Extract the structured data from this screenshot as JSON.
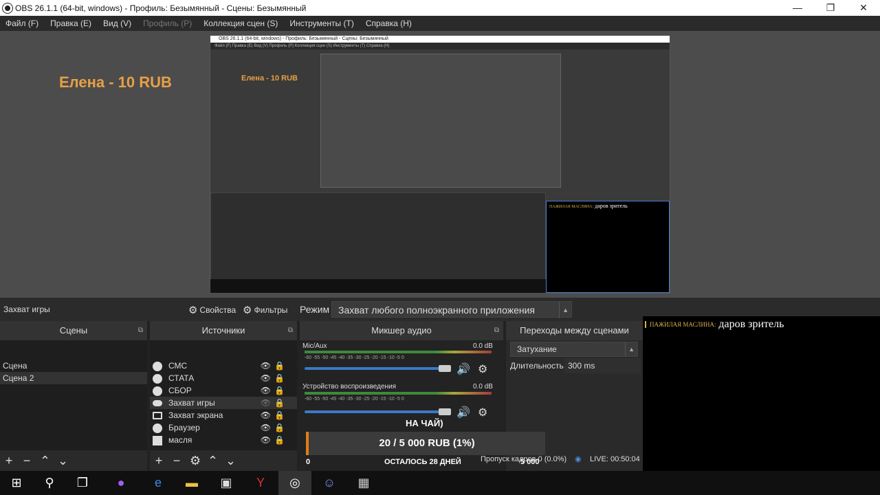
{
  "window": {
    "title": "OBS 26.1.1 (64-bit, windows) - Профиль: Безымянный - Сцены: Безымянный",
    "minimize": "—",
    "maximize": "❐",
    "close": "✕"
  },
  "menu": {
    "items": [
      {
        "label": "Файл (F)",
        "disabled": false
      },
      {
        "label": "Правка (E)",
        "disabled": false
      },
      {
        "label": "Вид (V)",
        "disabled": false
      },
      {
        "label": "Профиль (P)",
        "disabled": true
      },
      {
        "label": "Коллекция сцен (S)",
        "disabled": false
      },
      {
        "label": "Инструменты (T)",
        "disabled": false
      },
      {
        "label": "Справка (H)",
        "disabled": false
      }
    ]
  },
  "preview": {
    "donor_label": "Елена - 10 RUB",
    "nested_title": "OBS 26.1.1 (64-bit, windows) - Профиль: Безымянный - Сцены: Безымянный",
    "nested_menu": "Файл (F)   Правка (E)   Вид (V)   Профиль (P)   Коллекция сцен (S)   Инструменты (T)   Справка (H)",
    "nested_chat_user": "ПАЖИЛАЯ МАСЛИНА:",
    "nested_chat_text": "даров зритель"
  },
  "source_bar": {
    "source_name": "Захват игры",
    "properties_label": "Свойства",
    "filters_label": "Фильтры",
    "mode_label": "Режим",
    "mode_value": "Захват любого полноэкранного приложения"
  },
  "scenes": {
    "title": "Сцены",
    "items": [
      {
        "label": "Сцена",
        "selected": false
      },
      {
        "label": "Сцена 2",
        "selected": true
      }
    ]
  },
  "sources": {
    "title": "Источники",
    "items": [
      {
        "label": "СМС",
        "icon": "globe",
        "visible": true,
        "selected": false
      },
      {
        "label": "СТАТА",
        "icon": "globe",
        "visible": true,
        "selected": false
      },
      {
        "label": "СБОР",
        "icon": "globe",
        "visible": true,
        "selected": false
      },
      {
        "label": "Захват игры",
        "icon": "gamepad",
        "visible": false,
        "selected": true
      },
      {
        "label": "Захват экрана",
        "icon": "monitor",
        "visible": true,
        "selected": false
      },
      {
        "label": "Браузер",
        "icon": "globe",
        "visible": true,
        "selected": false
      },
      {
        "label": "масля",
        "icon": "image",
        "visible": true,
        "selected": false
      }
    ]
  },
  "mixer": {
    "title": "Микшер аудио",
    "channels": [
      {
        "name": "Mic/Aux",
        "db": "0.0 dB",
        "level": 0.55
      },
      {
        "name": "Устройство воспроизведения",
        "db": "0.0 dB",
        "level": 0.6
      }
    ],
    "ticks": "-60  -55  -50  -45  -40  -35  -30  -25  -20  -15  -10   -5   0"
  },
  "transitions": {
    "title": "Переходы между сценами",
    "transition_value": "Затухание",
    "duration_label": "Длительность",
    "duration_value": "300 ms"
  },
  "overlay": {
    "goal_title": "НА ЧАЙ)",
    "goal_amount": "20 / 5 000 RUB (1%)",
    "goal_min": "0",
    "goal_max": "5 000",
    "goal_remaining": "ОСТАЛОСЬ 28 ДНЕЙ",
    "progress": 0.01
  },
  "chat": {
    "username": "ПАЖИЛАЯ МАСЛИНА:",
    "message": "даров зритель"
  },
  "status": {
    "dropped": "Пропуск кадров 0 (0.0%)",
    "live": "LIVE: 00:50:04"
  },
  "taskbar": {
    "items": [
      "windows-start",
      "search",
      "task-view",
      "alice",
      "edge",
      "explorer",
      "store",
      "yandex",
      "obs",
      "discord",
      "gta"
    ]
  }
}
